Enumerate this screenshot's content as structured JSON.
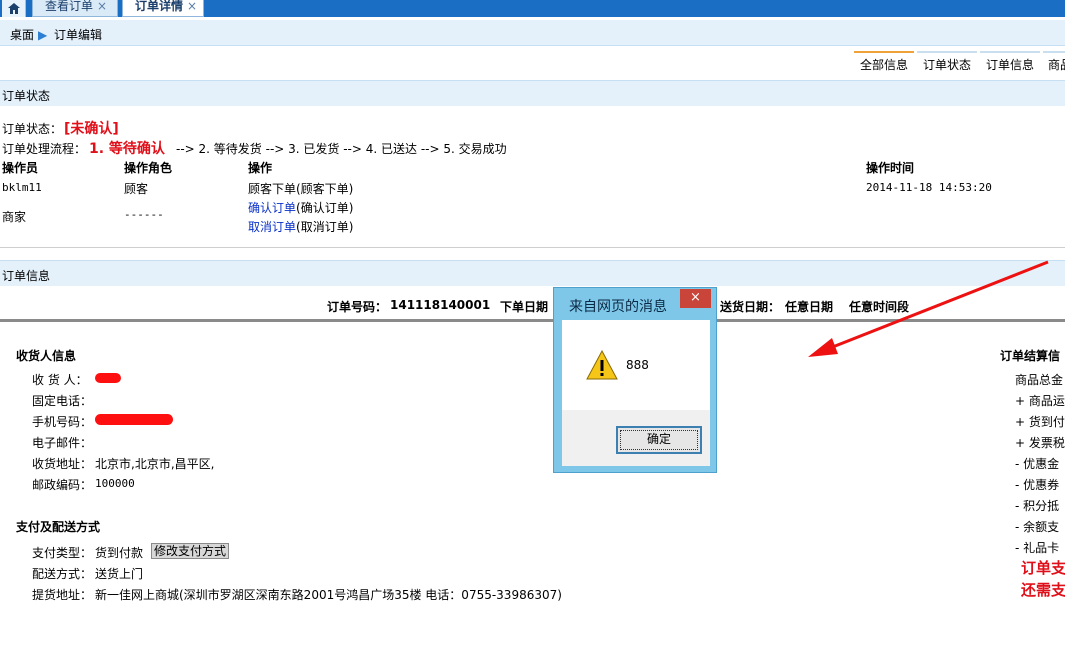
{
  "tabs": [
    {
      "label": "查看订单"
    },
    {
      "label": "订单详情"
    }
  ],
  "close_glyph": "×",
  "breadcrumb": {
    "home": "桌面",
    "current": "订单编辑"
  },
  "right_tabs": [
    "全部信息",
    "订单状态",
    "订单信息",
    "商品"
  ],
  "status_section": {
    "title": "订单状态",
    "status_label": "订单状态：",
    "status_value": "[未确认]",
    "flow_label": "订单处理流程：",
    "flow_current": "1. 等待确认",
    "flow_rest": "--> 2. 等待发货 --> 3. 已发货 --> 4. 已送达 --> 5. 交易成功",
    "columns": [
      "操作员",
      "操作角色",
      "操作",
      "操作时间"
    ],
    "rows": [
      {
        "operator": "bklm11",
        "role": "顾客",
        "action": "顾客下单(顾客下单)",
        "time": "2014-11-18 14:53:20"
      },
      {
        "operator": "商家",
        "role": "------",
        "action_link1": "确认订单",
        "action_rest1": "(确认订单)",
        "action_link2": "取消订单",
        "action_rest2": "(取消订单)"
      }
    ]
  },
  "order_section": {
    "title": "订单信息",
    "order_no_label": "订单号码：",
    "order_no": "141118140001",
    "order_date_label": "下单日期",
    "delivery_date_label": "送货日期：",
    "delivery_date": "任意日期",
    "delivery_time": "任意时间段"
  },
  "consignee": {
    "title": "收货人信息",
    "name_label": "收 货 人：",
    "phone_label": "固定电话：",
    "mobile_label": "手机号码：",
    "email_label": "电子邮件：",
    "address_label": "收货地址：",
    "address": "北京市,北京市,昌平区,",
    "zip_label": "邮政编码：",
    "zip": "100000"
  },
  "payment": {
    "title": "支付及配送方式",
    "pay_type_label": "支付类型：",
    "pay_type": "货到付款",
    "modify_button": "修改支付方式",
    "delivery_label": "配送方式：",
    "delivery": "送货上门",
    "pickup_label": "提货地址：",
    "pickup": "新一佳网上商城(深圳市罗湖区深南东路2001号鸿昌广场35楼 电话：0755-33986307)"
  },
  "settlement": {
    "title": "订单结算信",
    "items": [
      "商品总金",
      "+ 商品运",
      "+ 货到付",
      "+ 发票税",
      "- 优惠金",
      "- 优惠券",
      "- 积分抵",
      "- 余额支",
      "- 礼品卡"
    ],
    "total1": "订单支",
    "total2": "还需支"
  },
  "dialog": {
    "title": "来自网页的消息",
    "close": "×",
    "message": "888",
    "ok": "确定"
  },
  "colors": {
    "accent_red": "#e0101a",
    "link_blue": "#0a30c8",
    "dialog_frame": "#7ec7e9"
  }
}
